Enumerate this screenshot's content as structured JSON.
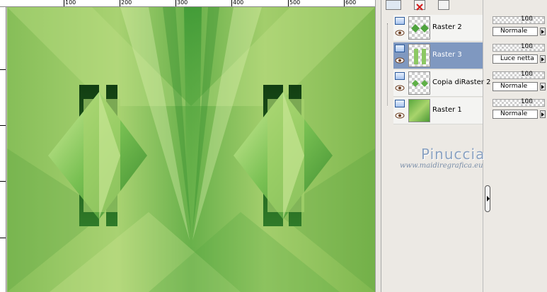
{
  "ruler": {
    "labels": [
      "100",
      "200",
      "300",
      "400",
      "500",
      "600"
    ]
  },
  "canvas_image": {
    "description_colors": {
      "background": "#7fb84f",
      "light": "#b9dd7c",
      "dark": "#1f5a1c"
    }
  },
  "layers_panel": {
    "layers": [
      {
        "name": "Raster 2",
        "opacity": "100",
        "blend": "Normale",
        "selected": false
      },
      {
        "name": "Raster 3",
        "opacity": "100",
        "blend": "Luce netta",
        "selected": true
      },
      {
        "name": "Copia diRaster 2",
        "opacity": "100",
        "blend": "Normale",
        "selected": false
      },
      {
        "name": "Raster 1",
        "opacity": "100",
        "blend": "Normale",
        "selected": false
      }
    ],
    "selection_color": "#7f98c0"
  },
  "watermark": {
    "name": "Pinuccia",
    "url": "www.maidiregrafica.eu"
  }
}
